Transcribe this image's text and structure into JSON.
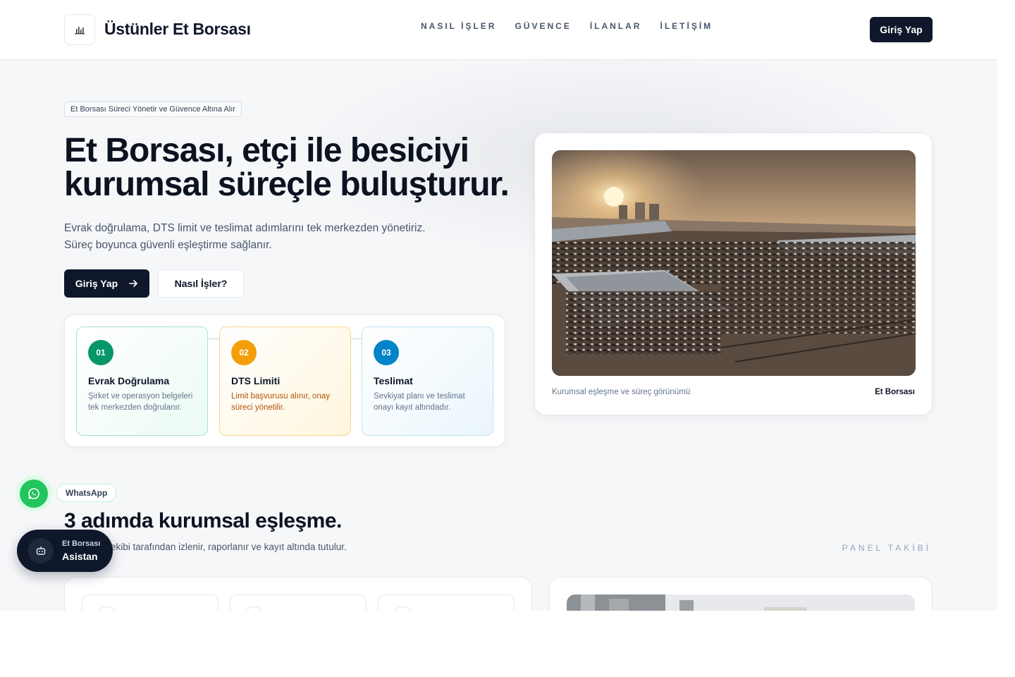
{
  "header": {
    "brand": "Üstünler Et Borsası",
    "logo_icon": "bar-chart-icon",
    "nav": [
      "NASIL İŞLER",
      "GÜVENCE",
      "İLANLAR",
      "İLETİŞİM"
    ],
    "login": "Giriş Yap"
  },
  "hero": {
    "badge": "Et Borsası Süreci Yönetir ve Güvence Altına Alır",
    "title_line1": "Et Borsası, etçi ile besiciyi",
    "title_line2": "kurumsal süreçle buluşturur.",
    "desc_line1": "Evrak doğrulama, DTS limit ve teslimat adımlarını tek merkezden yönetiriz.",
    "desc_line2": "Süreç boyunca güvenli eşleştirme sağlanır.",
    "cta_primary": "Giriş Yap",
    "cta_primary_icon": "arrow-right-icon",
    "cta_secondary": "Nasıl İşler?",
    "steps": [
      {
        "num": "01",
        "title": "Evrak Doğrulama",
        "desc": "Şirket ve operasyon belgeleri tek merkezden doğrulanır.",
        "color": "#059669"
      },
      {
        "num": "02",
        "title": "DTS Limiti",
        "desc": "Limit başvurusu alınır, onay süreci yönetilir.",
        "color": "#f59e0b"
      },
      {
        "num": "03",
        "title": "Teslimat",
        "desc": "Sevkiyat planı ve teslimat onayı kayıt altındadır.",
        "color": "#0284c7"
      }
    ],
    "image_caption": "Kurumsal eşleşme ve süreç görünümü",
    "image_brand": "Et Borsası"
  },
  "section": {
    "title": "3 adımda kurumsal eşleşme.",
    "desc": "Et Borsası ekibi tarafından izlenir, raporlanır ve kayıt altında tutulur.",
    "panel_label": "PANEL TAKİBİ"
  },
  "widgets": {
    "whatsapp_label": "WhatsApp",
    "whatsapp_icon": "whatsapp-icon",
    "assistant_sub": "Et Borsası",
    "assistant_main": "Asistan",
    "assistant_icon": "robot-icon"
  },
  "colors": {
    "primary": "#0f172a",
    "green": "#059669",
    "amber": "#f59e0b",
    "blue": "#0284c7",
    "whatsapp": "#22c55e"
  }
}
